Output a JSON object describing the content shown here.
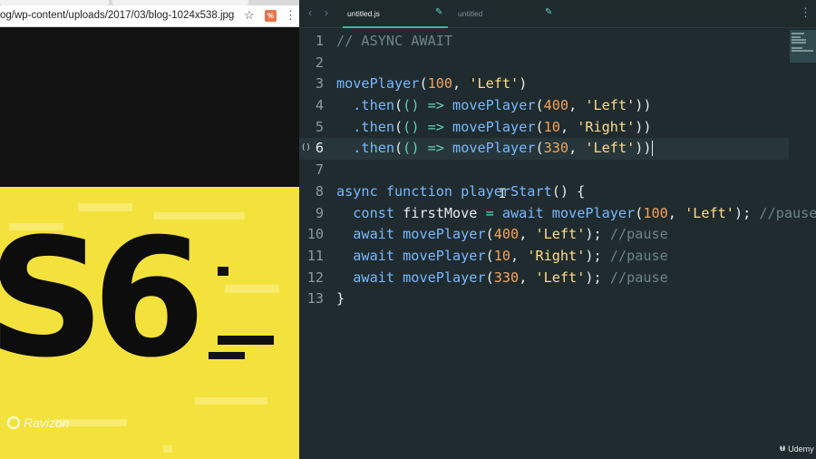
{
  "browser": {
    "url": "og/wp-content/uploads/2017/03/blog-1024x538.jpg",
    "image_text": "S6",
    "watermark": "Ravizon"
  },
  "editor": {
    "tabs": [
      {
        "label": "untitled.js",
        "active": true
      },
      {
        "label": "untitled",
        "active": false
      }
    ],
    "active_line": 6,
    "fold_marker": "()",
    "lines": [
      {
        "n": "1",
        "tokens": [
          {
            "t": "// ASYNC AWAIT",
            "c": "cm"
          }
        ]
      },
      {
        "n": "2",
        "tokens": []
      },
      {
        "n": "3",
        "tokens": [
          {
            "t": "movePlayer",
            "c": "fn"
          },
          {
            "t": "(",
            "c": "pl"
          },
          {
            "t": "100",
            "c": "num"
          },
          {
            "t": ", ",
            "c": "pl"
          },
          {
            "t": "'Left'",
            "c": "str"
          },
          {
            "t": ")",
            "c": "pl"
          }
        ]
      },
      {
        "n": "4",
        "tokens": [
          {
            "t": "  .then",
            "c": "fn"
          },
          {
            "t": "(",
            "c": "pl"
          },
          {
            "t": "() =>",
            "c": "op"
          },
          {
            "t": " ",
            "c": "pl"
          },
          {
            "t": "movePlayer",
            "c": "fn"
          },
          {
            "t": "(",
            "c": "pl"
          },
          {
            "t": "400",
            "c": "num"
          },
          {
            "t": ", ",
            "c": "pl"
          },
          {
            "t": "'Left'",
            "c": "str"
          },
          {
            "t": "))",
            "c": "pl"
          }
        ]
      },
      {
        "n": "5",
        "tokens": [
          {
            "t": "  .then",
            "c": "fn"
          },
          {
            "t": "(",
            "c": "pl"
          },
          {
            "t": "() =>",
            "c": "op"
          },
          {
            "t": " ",
            "c": "pl"
          },
          {
            "t": "movePlayer",
            "c": "fn"
          },
          {
            "t": "(",
            "c": "pl"
          },
          {
            "t": "10",
            "c": "num"
          },
          {
            "t": ", ",
            "c": "pl"
          },
          {
            "t": "'Right'",
            "c": "str"
          },
          {
            "t": "))",
            "c": "pl"
          }
        ]
      },
      {
        "n": "6",
        "tokens": [
          {
            "t": "  .then",
            "c": "fn"
          },
          {
            "t": "(",
            "c": "pl"
          },
          {
            "t": "() =>",
            "c": "op"
          },
          {
            "t": " ",
            "c": "pl"
          },
          {
            "t": "movePlayer",
            "c": "fn"
          },
          {
            "t": "(",
            "c": "pl"
          },
          {
            "t": "330",
            "c": "num"
          },
          {
            "t": ", ",
            "c": "pl"
          },
          {
            "t": "'Left'",
            "c": "str"
          },
          {
            "t": "))",
            "c": "pl"
          }
        ]
      },
      {
        "n": "7",
        "tokens": []
      },
      {
        "n": "8",
        "tokens": [
          {
            "t": "async function ",
            "c": "kw"
          },
          {
            "t": "playerStart",
            "c": "fn"
          },
          {
            "t": "() {",
            "c": "pl"
          }
        ]
      },
      {
        "n": "9",
        "tokens": [
          {
            "t": "  const ",
            "c": "kw"
          },
          {
            "t": "firstMove ",
            "c": "pl"
          },
          {
            "t": "= ",
            "c": "op"
          },
          {
            "t": "await ",
            "c": "kw"
          },
          {
            "t": "movePlayer",
            "c": "fn"
          },
          {
            "t": "(",
            "c": "pl"
          },
          {
            "t": "100",
            "c": "num"
          },
          {
            "t": ", ",
            "c": "pl"
          },
          {
            "t": "'Left'",
            "c": "str"
          },
          {
            "t": "); ",
            "c": "pl"
          },
          {
            "t": "//pause",
            "c": "cm"
          }
        ]
      },
      {
        "n": "10",
        "tokens": [
          {
            "t": "  await ",
            "c": "kw"
          },
          {
            "t": "movePlayer",
            "c": "fn"
          },
          {
            "t": "(",
            "c": "pl"
          },
          {
            "t": "400",
            "c": "num"
          },
          {
            "t": ", ",
            "c": "pl"
          },
          {
            "t": "'Left'",
            "c": "str"
          },
          {
            "t": "); ",
            "c": "pl"
          },
          {
            "t": "//pause",
            "c": "cm"
          }
        ]
      },
      {
        "n": "11",
        "tokens": [
          {
            "t": "  await ",
            "c": "kw"
          },
          {
            "t": "movePlayer",
            "c": "fn"
          },
          {
            "t": "(",
            "c": "pl"
          },
          {
            "t": "10",
            "c": "num"
          },
          {
            "t": ", ",
            "c": "pl"
          },
          {
            "t": "'Right'",
            "c": "str"
          },
          {
            "t": "); ",
            "c": "pl"
          },
          {
            "t": "//pause",
            "c": "cm"
          }
        ]
      },
      {
        "n": "12",
        "tokens": [
          {
            "t": "  await ",
            "c": "kw"
          },
          {
            "t": "movePlayer",
            "c": "fn"
          },
          {
            "t": "(",
            "c": "pl"
          },
          {
            "t": "330",
            "c": "num"
          },
          {
            "t": ", ",
            "c": "pl"
          },
          {
            "t": "'Left'",
            "c": "str"
          },
          {
            "t": "); ",
            "c": "pl"
          },
          {
            "t": "//pause",
            "c": "cm"
          }
        ]
      },
      {
        "n": "13",
        "tokens": [
          {
            "t": "}",
            "c": "pl"
          }
        ]
      }
    ]
  },
  "brand": {
    "label": "Udemy"
  },
  "icons": {
    "back": "chevron-left-icon",
    "forward": "chevron-right-icon",
    "star": "star-icon",
    "menu": "kebab-menu-icon",
    "edit": "pencil-icon"
  },
  "colors": {
    "editor_bg": "#1f2b2e",
    "function": "#79b8ff",
    "number": "#f5a35c",
    "string": "#ffdd8a",
    "comment": "#6f8488",
    "tab_accent": "#3ab6a0",
    "image_yellow": "#f4e23c"
  }
}
